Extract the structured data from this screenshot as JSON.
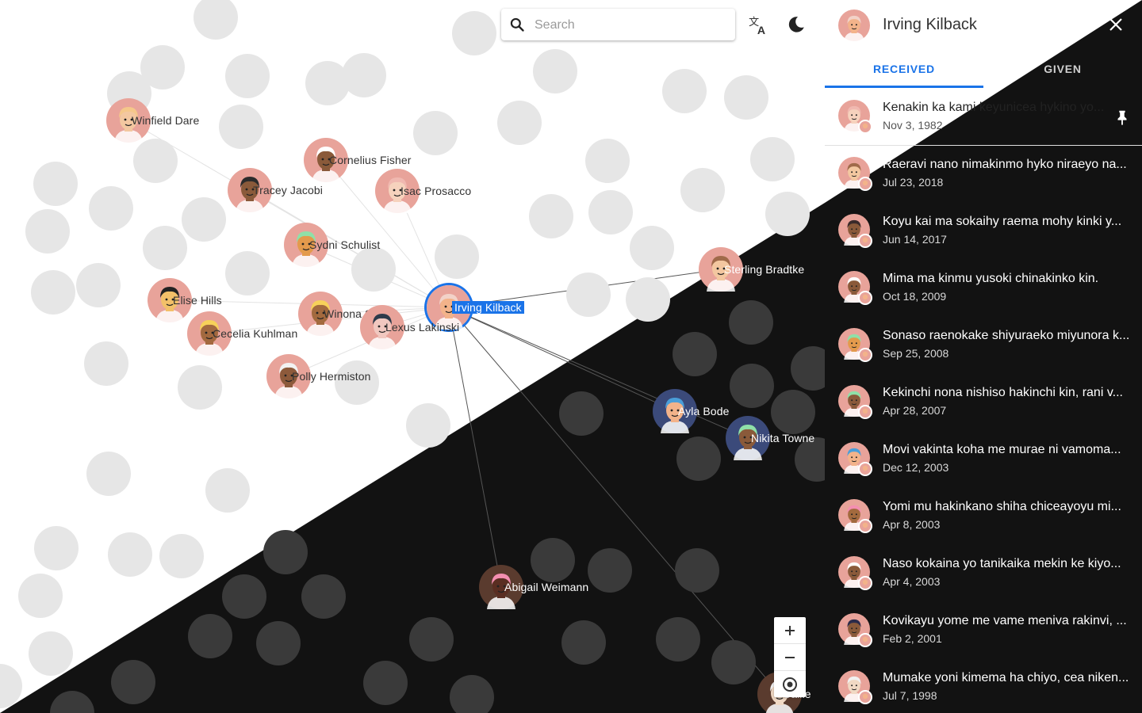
{
  "search": {
    "placeholder": "Search"
  },
  "toolbar": {
    "translate_icon": "translate-icon",
    "theme_icon": "dark-mode-icon"
  },
  "zoom_controls": {
    "zoom_in_icon": "plus-icon",
    "zoom_out_icon": "minus-icon",
    "center_icon": "target-icon"
  },
  "nodes": [
    {
      "label": "Winfield Dare",
      "skin": "#f3c7a0",
      "hair": "#f5c78a",
      "bg": "#e8a39a",
      "theme": "light"
    },
    {
      "label": "Cornelius Fisher",
      "skin": "#8a5a3a",
      "hair": "#ffffff",
      "bg": "#e8a39a",
      "theme": "light"
    },
    {
      "label": "Tracey Jacobi",
      "skin": "#8a5a3a",
      "hair": "#2b2b2b",
      "bg": "#e8a39a",
      "theme": "light"
    },
    {
      "label": "Isac Prosacco",
      "skin": "#f6d2bd",
      "hair": "#f0b8b0",
      "bg": "#e8a39a",
      "theme": "light"
    },
    {
      "label": "Sydni Schulist",
      "skin": "#e39a4c",
      "hair": "#8fe0a8",
      "bg": "#e8a39a",
      "theme": "light"
    },
    {
      "label": "Irving Kilback",
      "skin": "#f3b38a",
      "hair": "#f2d2c8",
      "bg": "#e8a39a",
      "theme": "light",
      "selected": true
    },
    {
      "label": "Elise Hills",
      "skin": "#f3c069",
      "hair": "#222222",
      "bg": "#e8a39a",
      "theme": "light"
    },
    {
      "label": "Winona Swift",
      "skin": "#a36a3e",
      "hair": "#f7d15a",
      "bg": "#e8a39a",
      "theme": "light"
    },
    {
      "label": "Lexus Lakinski",
      "skin": "#f1c8c0",
      "hair": "#2d3a4a",
      "bg": "#e8a39a",
      "theme": "light"
    },
    {
      "label": "Cecelia Kuhlman",
      "skin": "#a3693f",
      "hair": "#f7d15a",
      "bg": "#e8a39a",
      "theme": "light"
    },
    {
      "label": "Polly Hermiston",
      "skin": "#8d5a3b",
      "hair": "#f2f2f2",
      "bg": "#e8a39a",
      "theme": "light"
    },
    {
      "label": "Sterling Bradtke",
      "skin": "#f3c7a0",
      "hair": "#a06a4a",
      "bg": "#e8a39a",
      "theme": "light"
    },
    {
      "label": "Ayla Bode",
      "skin": "#f3b38a",
      "hair": "#4a9ed9",
      "bg": "#3b4a7a",
      "theme": "dark"
    },
    {
      "label": "Nikita Towne",
      "skin": "#8a5a3a",
      "hair": "#8fe0a8",
      "bg": "#3b4a7a",
      "theme": "dark"
    },
    {
      "label": "Abigail Weimann",
      "skin": "#5a2e22",
      "hair": "#f48fb1",
      "bg": "#5a3b2e",
      "theme": "dark"
    },
    {
      "label": "Callie",
      "skin": "#f1d9c4",
      "hair": "#f1f1f1",
      "bg": "#5a3b2e",
      "theme": "dark"
    }
  ],
  "panel": {
    "title": "Irving Kilback",
    "close_icon": "close-icon",
    "tabs": [
      {
        "label": "RECEIVED",
        "active": true
      },
      {
        "label": "GIVEN",
        "active": false
      }
    ],
    "pinned_icon": "pin-icon",
    "messages": [
      {
        "text": "Kenakin ka kami keyunicea hykino yo...",
        "date": "Nov 3, 1982",
        "skin": "#f6d2bd",
        "hair": "#f0b8b0",
        "pinned": true
      },
      {
        "text": "Raeravi nano nimakinmo hyko niraeyo na...",
        "date": "Jul 23, 2018",
        "skin": "#f3c7a0",
        "hair": "#a06a4a"
      },
      {
        "text": "Koyu kai ma sokaihy raema mohy kinki y...",
        "date": "Jun 14, 2017",
        "skin": "#8a5a3a",
        "hair": "#3a2a2a"
      },
      {
        "text": "Mima ma kinmu yusoki chinakinko kin.",
        "date": "Oct 18, 2009",
        "skin": "#8a5a3a",
        "hair": "#ffffff"
      },
      {
        "text": "Sonaso raenokake shiyuraeko miyunora k...",
        "date": "Sep 25, 2008",
        "skin": "#e39a4c",
        "hair": "#8fe0a8"
      },
      {
        "text": "Kekinchi nona nishiso hakinchi kin, rani v...",
        "date": "Apr 28, 2007",
        "skin": "#8a5a3a",
        "hair": "#8fe0a8"
      },
      {
        "text": "Movi vakinta koha me murae ni vamoma...",
        "date": "Dec 12, 2003",
        "skin": "#f3b38a",
        "hair": "#4a9ed9"
      },
      {
        "text": "Yomi mu hakinkano shiha chiceayoyu mi...",
        "date": "Apr 8, 2003",
        "skin": "#a36a3e",
        "hair": "#f48fb1"
      },
      {
        "text": "Naso kokaina yo tanikaika mekin ke kiyo...",
        "date": "Apr 4, 2003",
        "skin": "#8a5a3a",
        "hair": "#ffffff"
      },
      {
        "text": "Kovikayu yome me vame meniva rakinvi, ...",
        "date": "Feb 2, 2001",
        "skin": "#8a5a3a",
        "hair": "#2b2b4a"
      },
      {
        "text": "Mumake yoni kimema ha chiyo, cea niken...",
        "date": "Jul 7, 1998",
        "skin": "#f1d9c4",
        "hair": "#f1f1f1"
      }
    ]
  }
}
